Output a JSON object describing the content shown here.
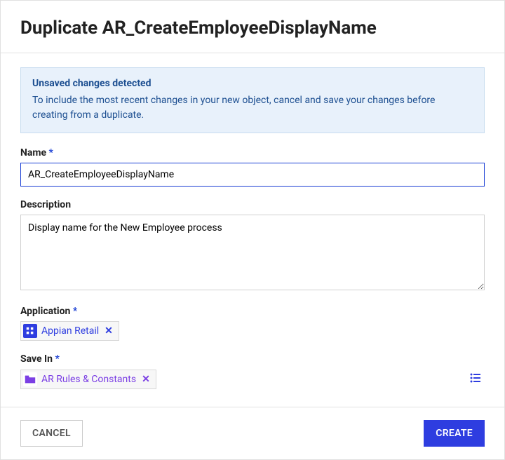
{
  "header": {
    "title": "Duplicate AR_CreateEmployeeDisplayName"
  },
  "warning": {
    "title": "Unsaved changes detected",
    "text": "To include the most recent changes in your new object, cancel and save your changes before creating from a duplicate."
  },
  "fields": {
    "name": {
      "label": "Name",
      "required": "*",
      "value": "AR_CreateEmployeeDisplayName"
    },
    "description": {
      "label": "Description",
      "value": "Display name for the New Employee process"
    },
    "application": {
      "label": "Application",
      "required": "*",
      "chip_label": "Appian Retail",
      "remove": "✕"
    },
    "save_in": {
      "label": "Save In",
      "required": "*",
      "chip_label": "AR Rules & Constants",
      "remove": "✕"
    }
  },
  "footer": {
    "cancel": "CANCEL",
    "create": "CREATE"
  }
}
